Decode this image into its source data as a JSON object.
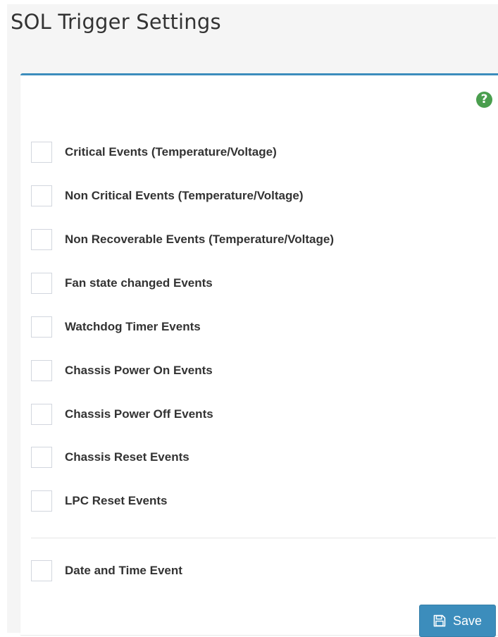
{
  "page": {
    "title": "SOL Trigger Settings"
  },
  "help": {
    "icon": "question-circle-icon",
    "glyph": "?"
  },
  "triggers": [
    {
      "label": "Critical Events (Temperature/Voltage)",
      "checked": false
    },
    {
      "label": "Non Critical Events (Temperature/Voltage)",
      "checked": false
    },
    {
      "label": "Non Recoverable Events (Temperature/Voltage)",
      "checked": false
    },
    {
      "label": "Fan state changed Events",
      "checked": false
    },
    {
      "label": "Watchdog Timer Events",
      "checked": false
    },
    {
      "label": "Chassis Power On Events",
      "checked": false
    },
    {
      "label": "Chassis Power Off Events",
      "checked": false
    },
    {
      "label": "Chassis Reset Events",
      "checked": false
    },
    {
      "label": "LPC Reset Events",
      "checked": false
    }
  ],
  "date_time": {
    "label": "Date and Time Event",
    "checked": false
  },
  "actions": {
    "save_label": "Save",
    "save_icon": "floppy-disk-icon"
  },
  "colors": {
    "accent": "#3c8dbc",
    "help": "#4a9e4e"
  }
}
